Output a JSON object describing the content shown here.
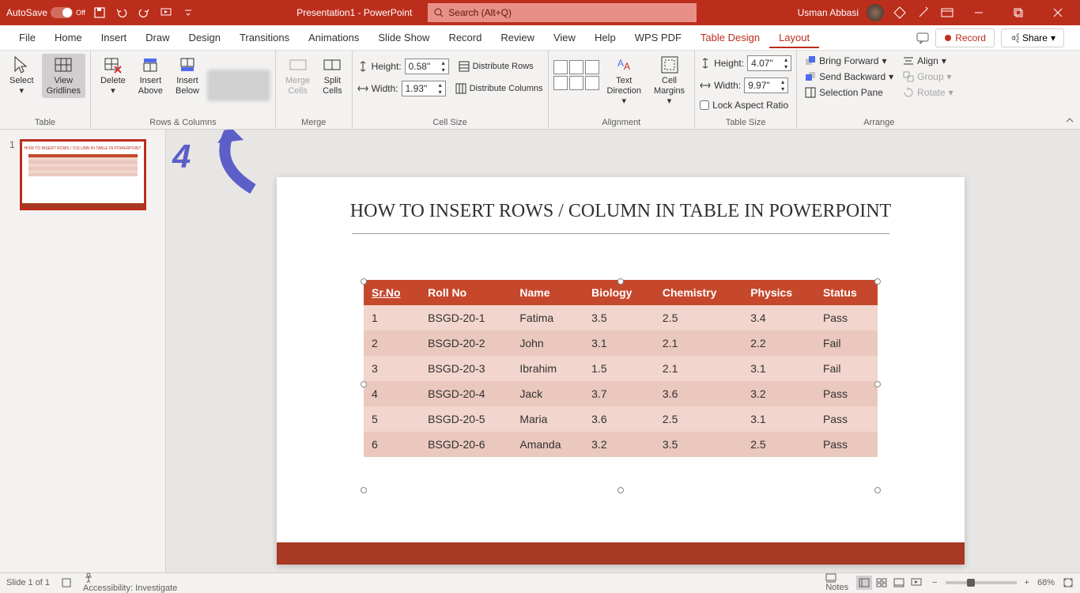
{
  "titlebar": {
    "autosave": "AutoSave",
    "autosave_state": "Off",
    "doc_title": "Presentation1 - PowerPoint",
    "search_placeholder": "Search (Alt+Q)",
    "user": "Usman Abbasi"
  },
  "menubar": {
    "tabs": [
      "File",
      "Home",
      "Insert",
      "Draw",
      "Design",
      "Transitions",
      "Animations",
      "Slide Show",
      "Record",
      "Review",
      "View",
      "Help",
      "WPS PDF",
      "Table Design",
      "Layout"
    ],
    "comments_icon": "comments-icon",
    "record": "Record",
    "share": "Share"
  },
  "ribbon": {
    "table": {
      "select": "Select",
      "view_gridlines": "View\nGridlines",
      "label": "Table"
    },
    "rows_cols": {
      "delete": "Delete",
      "insert_above": "Insert\nAbove",
      "insert_below": "Insert\nBelow",
      "label": "Rows & Columns"
    },
    "merge": {
      "merge": "Merge\nCells",
      "split": "Split\nCells",
      "label": "Merge"
    },
    "cell_size": {
      "height_lbl": "Height:",
      "width_lbl": "Width:",
      "height_val": "0.58\"",
      "width_val": "1.93\"",
      "dist_rows": "Distribute Rows",
      "dist_cols": "Distribute Columns",
      "label": "Cell Size"
    },
    "alignment": {
      "text_dir": "Text\nDirection",
      "cell_margins": "Cell\nMargins",
      "label": "Alignment"
    },
    "table_size": {
      "height_lbl": "Height:",
      "width_lbl": "Width:",
      "height_val": "4.07\"",
      "width_val": "9.97\"",
      "lock": "Lock Aspect Ratio",
      "label": "Table Size"
    },
    "arrange": {
      "bring_fwd": "Bring Forward",
      "send_bwd": "Send Backward",
      "selection": "Selection Pane",
      "align": "Align",
      "group": "Group",
      "rotate": "Rotate",
      "label": "Arrange"
    }
  },
  "thumb": {
    "num": "1",
    "title": "HOW TO INSERT ROWS / COLUMN IN TABLE IN POWERPOINT"
  },
  "slide": {
    "title": "HOW TO INSERT ROWS / COLUMN IN TABLE IN POWERPOINT",
    "headers": [
      "Sr.No",
      "Roll No",
      "Name",
      "Biology",
      "Chemistry",
      "Physics",
      "Status"
    ],
    "rows": [
      [
        "1",
        "BSGD-20-1",
        "Fatima",
        "3.5",
        "2.5",
        "3.4",
        "Pass"
      ],
      [
        "2",
        "BSGD-20-2",
        "John",
        "3.1",
        "2.1",
        "2.2",
        "Fail"
      ],
      [
        "3",
        "BSGD-20-3",
        "Ibrahim",
        "1.5",
        "2.1",
        "3.1",
        "Fail"
      ],
      [
        "4",
        "BSGD-20-4",
        "Jack",
        "3.7",
        "3.6",
        "3.2",
        "Pass"
      ],
      [
        "5",
        "BSGD-20-5",
        "Maria",
        "3.6",
        "2.5",
        "3.1",
        "Pass"
      ],
      [
        "6",
        "BSGD-20-6",
        "Amanda",
        "3.2",
        "3.5",
        "2.5",
        "Pass"
      ]
    ]
  },
  "annotation": {
    "step": "4"
  },
  "status": {
    "slide": "Slide 1 of 1",
    "access": "Accessibility: Investigate",
    "notes": "Notes",
    "zoom": "68%"
  }
}
